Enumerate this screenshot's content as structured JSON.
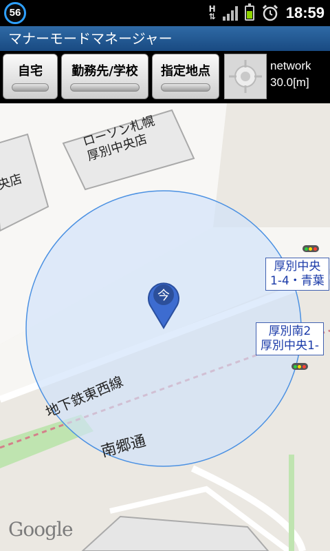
{
  "status": {
    "badge": "56",
    "network_type": "H",
    "time": "18:59"
  },
  "app": {
    "title": "マナーモードマネージャー"
  },
  "toolbar": {
    "home_label": "自宅",
    "work_label": "勤務先/学校",
    "place_label": "指定地点",
    "provider": "network",
    "accuracy": "30.0[m]"
  },
  "map": {
    "store_labels": [
      "ローソン札幌",
      "厚別中央店"
    ],
    "left_store_fragment": "央店",
    "bus_stop_1": [
      "厚別中央",
      "1-4・青葉"
    ],
    "bus_stop_2": [
      "厚別南2",
      "厚別中央1-"
    ],
    "subway_label": "地下鉄東西線",
    "street_label": "南郷通",
    "marker_label": "今",
    "attribution": "Google",
    "accuracy_circle_color": "#4a90e2"
  }
}
